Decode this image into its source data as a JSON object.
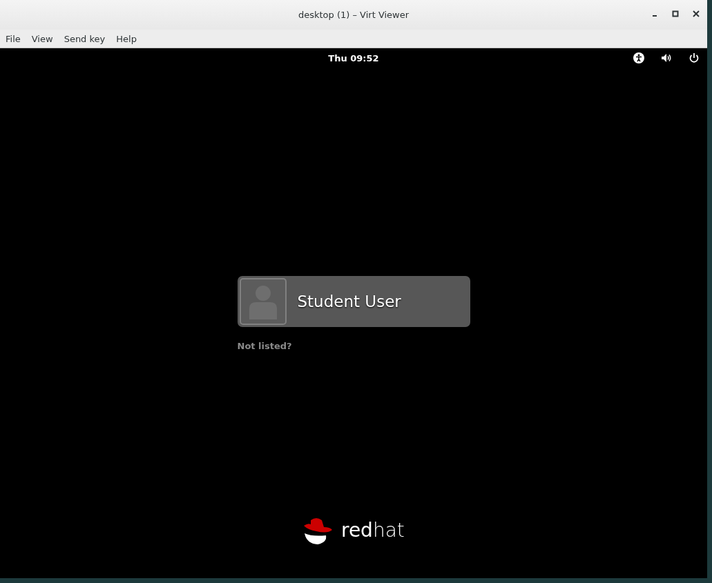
{
  "window": {
    "title": "desktop (1) – Virt Viewer"
  },
  "menu": [
    "File",
    "View",
    "Send key",
    "Help"
  ],
  "top_bar": {
    "clock": "Thu 09:52"
  },
  "login": {
    "users": [
      {
        "name": "Student User",
        "selected": false
      }
    ],
    "not_listed": "Not listed?"
  },
  "logo": {
    "text": "**red**hat"
  }
}
